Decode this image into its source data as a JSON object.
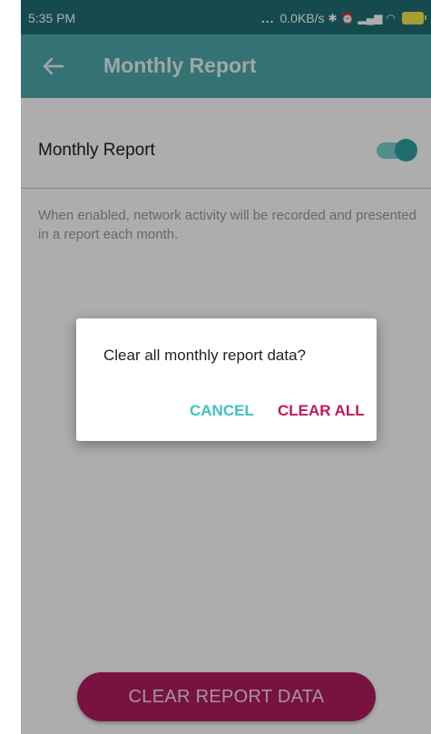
{
  "status_bar": {
    "time": "5:35 PM",
    "network_speed": "0.0KB/s",
    "icons": [
      "bluetooth-icon",
      "alarm-icon",
      "signal-icon",
      "wifi-icon",
      "battery-charging-icon"
    ]
  },
  "app_bar": {
    "title": "Monthly Report",
    "back_icon": "arrow-back-icon"
  },
  "setting": {
    "label": "Monthly Report",
    "enabled": true,
    "description": "When enabled, network activity will be recorded and presented in a report each month."
  },
  "clear_button_label": "CLEAR REPORT DATA",
  "dialog": {
    "message": "Clear all monthly report data?",
    "cancel_label": "CANCEL",
    "confirm_label": "CLEAR ALL"
  },
  "colors": {
    "app_bar": "#4fa9ac",
    "status_bar": "#206f73",
    "accent": "#2f9fa3",
    "danger": "#c2185b",
    "button": "#b21c60"
  }
}
